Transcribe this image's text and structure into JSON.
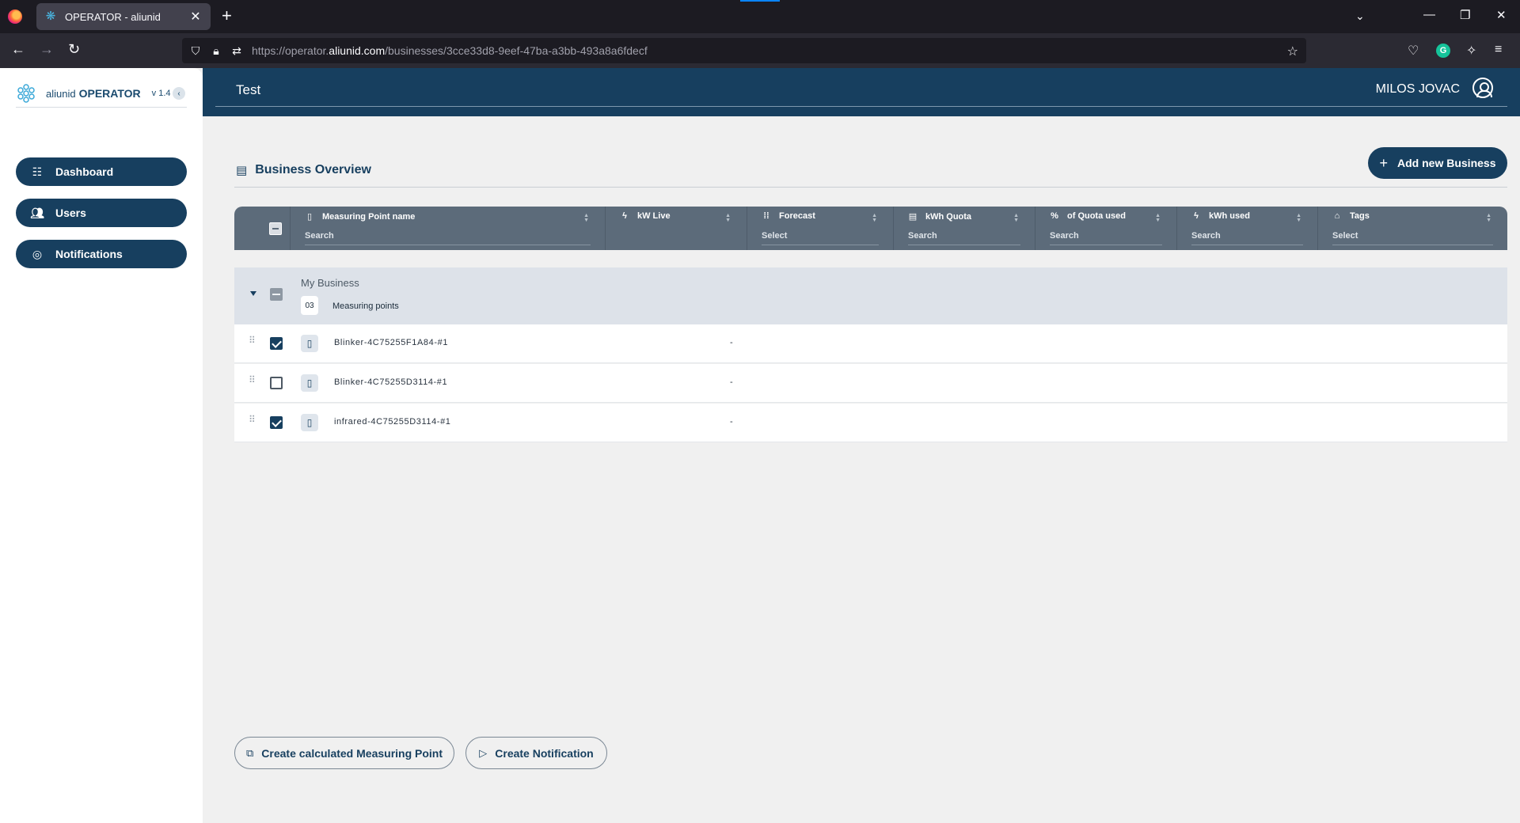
{
  "browser": {
    "tab_title": "OPERATOR - aliunid",
    "url_prefix": "https://operator.",
    "url_domain": "aliunid.com",
    "url_path": "/businesses/3cce33d8-9eef-47ba-a3bb-493a8a6fdecf"
  },
  "sidebar": {
    "brand": "aliunid",
    "product": "OPERATOR",
    "version": "v 1.4",
    "items": [
      {
        "label": "Dashboard",
        "icon": "dashboard-icon"
      },
      {
        "label": "Users",
        "icon": "users-icon"
      },
      {
        "label": "Notifications",
        "icon": "notifications-icon"
      }
    ]
  },
  "header": {
    "title": "Test",
    "user": "MILOS JOVAC"
  },
  "section": {
    "title": "Business Overview",
    "add_button": "Add new Business"
  },
  "table": {
    "columns": [
      {
        "label": "Measuring Point name",
        "filter": "Search",
        "icon": "measuring-point-icon"
      },
      {
        "label": "kW Live",
        "filter": "",
        "icon": "bolt-icon"
      },
      {
        "label": "Forecast",
        "filter": "Select",
        "icon": "grid-icon"
      },
      {
        "label": "kWh Quota",
        "filter": "Search",
        "icon": "quota-icon"
      },
      {
        "label": "of Quota used",
        "filter": "Search",
        "icon": "percent-icon"
      },
      {
        "label": "kWh used",
        "filter": "Search",
        "icon": "bolt-icon"
      },
      {
        "label": "Tags",
        "filter": "Select",
        "icon": "tag-icon"
      }
    ],
    "group": {
      "name": "My Business",
      "count": "03",
      "count_label": "Measuring points"
    },
    "rows": [
      {
        "name": "Blinker-4C75255F1A84-#1",
        "kw_live": "-",
        "checked": true
      },
      {
        "name": "Blinker-4C75255D3114-#1",
        "kw_live": "-",
        "checked": false
      },
      {
        "name": "infrared-4C75255D3114-#1",
        "kw_live": "-",
        "checked": true
      }
    ]
  },
  "footer": {
    "calc_button": "Create calculated Measuring Point",
    "notify_button": "Create Notification"
  },
  "colors": {
    "primary": "#173f5f",
    "table_header": "#5c6b7a",
    "group_row": "#dde2e9"
  }
}
